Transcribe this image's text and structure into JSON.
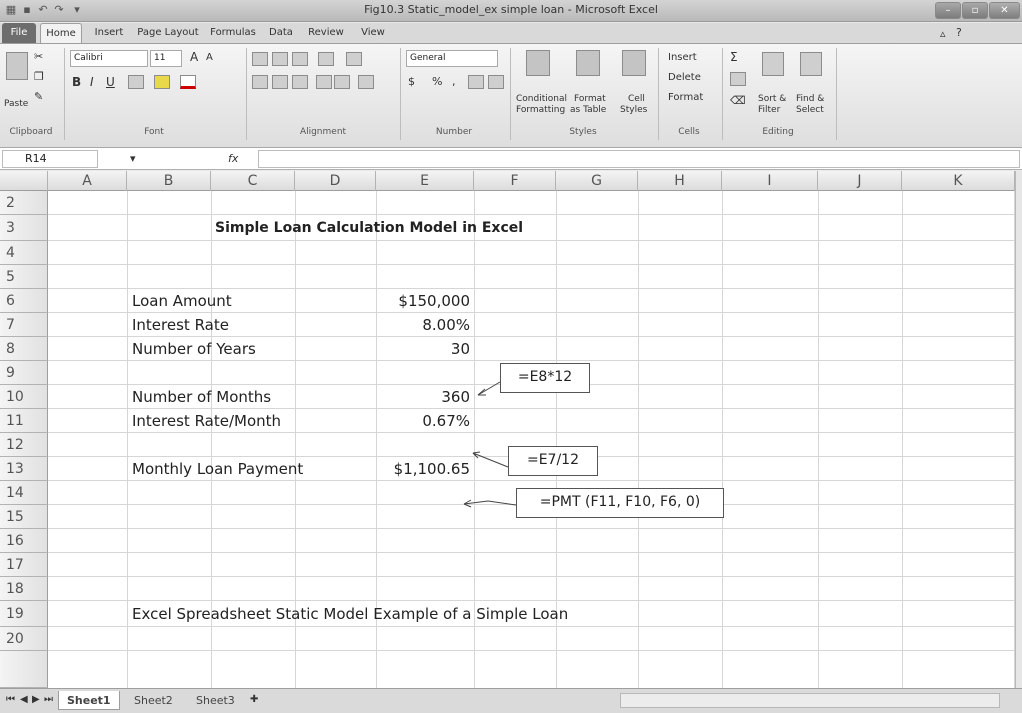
{
  "window": {
    "title": "Fig10.3 Static_model_ex simple loan - Microsoft Excel",
    "controls": [
      "–",
      "▫",
      "✕"
    ]
  },
  "ribbon": {
    "tabs": [
      "File",
      "Home",
      "Insert",
      "Page Layout",
      "Formulas",
      "Data",
      "Review",
      "View"
    ],
    "clipboard": {
      "paste": "Paste",
      "label": "Clipboard"
    },
    "font": {
      "name": "Calibri",
      "size": "11",
      "label": "Font",
      "bold": "B",
      "italic": "I",
      "underline": "U"
    },
    "alignment": {
      "label": "Alignment"
    },
    "number": {
      "format": "General",
      "currency": "$",
      "percent": "%",
      "comma": ",",
      "label": "Number"
    },
    "styles": {
      "conditional": "Conditional",
      "conditional2": "Formatting",
      "format_table": "Format",
      "format_table2": "as Table",
      "cell_styles": "Cell",
      "cell_styles2": "Styles",
      "label": "Styles"
    },
    "cells": {
      "insert": "Insert",
      "delete": "Delete",
      "format": "Format",
      "label": "Cells"
    },
    "editing": {
      "sort": "Sort &",
      "sort2": "Filter",
      "find": "Find &",
      "find2": "Select",
      "label": "Editing"
    }
  },
  "formula_bar": {
    "name_box": "R14",
    "fx": "fx",
    "formula": ""
  },
  "grid": {
    "columns": [
      "A",
      "B",
      "C",
      "D",
      "E",
      "F",
      "G",
      "H",
      "I",
      "J",
      "K"
    ],
    "rows": [
      "2",
      "3",
      "4",
      "5",
      "6",
      "7",
      "8",
      "9",
      "10",
      "11",
      "12",
      "13",
      "14",
      "15",
      "16",
      "17",
      "18",
      "19",
      "20"
    ]
  },
  "sheet": {
    "title": "Simple Loan Calculation Model in Excel",
    "labels": {
      "loan_amount": "Loan Amount",
      "interest_rate": "Interest Rate",
      "num_years": "Number of Years",
      "num_months": "Number of Months",
      "rate_month": "Interest Rate/Month",
      "payment": "Monthly Loan Payment"
    },
    "values": {
      "loan_amount": "$150,000",
      "interest_rate": "8.00%",
      "num_years": "30",
      "num_months": "360",
      "rate_month": "0.67%",
      "payment": "$1,100.65"
    },
    "callouts": {
      "months": "=E8*12",
      "rate": "=E7/12",
      "pmt": "=PMT (F11, F10, F6, 0)"
    },
    "caption": "Excel Spreadsheet Static Model Example of a Simple Loan"
  },
  "sheet_tabs": [
    "Sheet1",
    "Sheet2",
    "Sheet3"
  ]
}
